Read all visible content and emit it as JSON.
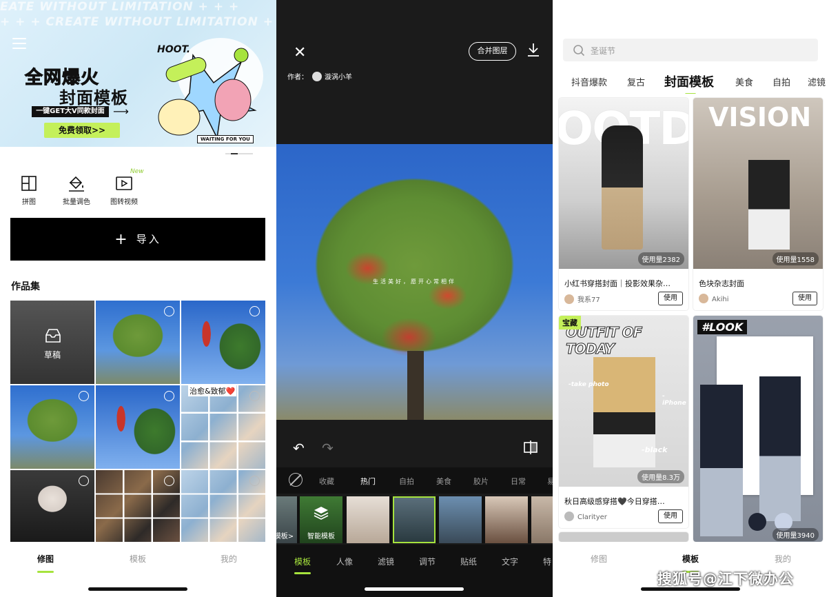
{
  "left": {
    "banner": {
      "ghost_text": "EATE WITHOUT LIMITATION + + +",
      "ghost_text_2": "+ + + CREATE WITHOUT LIMITATION +",
      "line1": "全网爆火",
      "line2": "封面模板",
      "tagline": "一键GET大V同款封面",
      "cta": "免费领取>>",
      "art_title": "HOOT.",
      "art_sub": "WAITING FOR YOU"
    },
    "tools": [
      {
        "label": "拼图",
        "icon": "collage-icon"
      },
      {
        "label": "批量调色",
        "icon": "paint-bucket-icon"
      },
      {
        "label": "图转视频",
        "icon": "video-play-icon"
      }
    ],
    "new_badge": "New",
    "import_label": "导入",
    "section_title": "作品集",
    "grid": {
      "draft_label": "草稿",
      "caption": "治愈&致郁❤️"
    },
    "tabs": [
      "修图",
      "模板",
      "我的"
    ],
    "active_tab": "修图"
  },
  "middle": {
    "merge_label": "合并图层",
    "author_prefix": "作者：",
    "author_name": "漩涡小羊",
    "overlay_text": "生活美好，愿开心常相伴",
    "categories": [
      "收藏",
      "热门",
      "自拍",
      "美食",
      "胶片",
      "日常",
      "易"
    ],
    "active_category": "热门",
    "strip": {
      "first_label": "模板>",
      "smart_label": "智能模板"
    },
    "tabs": [
      "模板",
      "人像",
      "滤镜",
      "调节",
      "贴纸",
      "文字",
      "特"
    ],
    "active_tab": "模板"
  },
  "right": {
    "search_placeholder": "圣诞节",
    "categories": [
      "抖音爆款",
      "复古",
      "封面模板",
      "美食",
      "自拍",
      "滤镜"
    ],
    "active_category": "封面模板",
    "cards": [
      {
        "cover_text": "OOTD",
        "uses": "使用量2382",
        "title": "小红书穿搭封面｜投影效果杂…",
        "user": "我系77",
        "button": "使用"
      },
      {
        "cover_text": "VISION",
        "uses": "使用量1558",
        "title": "色块杂志封面",
        "user": "Akihi",
        "button": "使用"
      },
      {
        "cover_text": "OUTFIT OF TODAY",
        "badge": "宝藏",
        "uses": "使用量8.3万",
        "title": "秋日高级感穿搭🖤今日穿搭…",
        "user": "Clarityer",
        "button": "使用",
        "stickers": [
          "-take photo",
          "-iPhone",
          "-black"
        ]
      },
      {
        "cover_text": "#LOOK",
        "uses": "使用量3940"
      }
    ],
    "tabs": [
      "修图",
      "模板",
      "我的"
    ],
    "active_tab": "模板",
    "watermark": "搜狐号@江下微办公"
  },
  "colors": {
    "accent": "#a6e33d",
    "cta": "#c4f05a"
  }
}
